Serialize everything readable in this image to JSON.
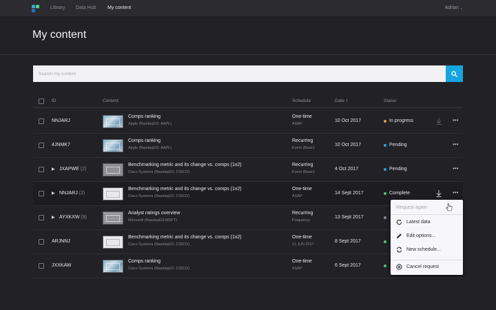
{
  "nav": {
    "links": [
      {
        "label": "Library"
      },
      {
        "label": "Data Hub"
      },
      {
        "label": "My content"
      }
    ],
    "user": "Adrian"
  },
  "page": {
    "title": "My content"
  },
  "search": {
    "placeholder": "Search my content"
  },
  "table": {
    "headers": {
      "id": "ID",
      "content": "Content",
      "schedule": "Schedule",
      "date": "Date",
      "status": "Status"
    },
    "sort": {
      "column": "Date",
      "direction": "ascending"
    },
    "rows": [
      {
        "id": "NNJARJ",
        "count": "",
        "expandable": false,
        "thumb": "blue",
        "title": "Comps ranking",
        "subtitle": "Apple (NasdaqGS: AAPL)",
        "schedule": "One-time",
        "schedule_detail": "ASAP",
        "date": "10 Oct 2017",
        "status": "In progress",
        "status_color": "#e8a32c",
        "download": true
      },
      {
        "id": "4JNMK7",
        "count": "",
        "expandable": false,
        "thumb": "blue",
        "title": "Comps ranking",
        "subtitle": "Apple (NasdaqGS: AAPL)",
        "schedule": "Recurring",
        "schedule_detail": "Event (Basic)",
        "date": "10 Oct 2017",
        "status": "Pending",
        "status_color": "#1fa8e6",
        "download": false
      },
      {
        "id": "JXAPWE",
        "count": "(2)",
        "expandable": true,
        "thumb": "grey",
        "title": "Benchmarking metric and its change vs. comps (1x2)",
        "subtitle": "Cisco Systems (NasdaqGS: CISCO)",
        "schedule": "Recurring",
        "schedule_detail": "Event (Basic)",
        "date": "4 Oct 2017",
        "status": "Pending",
        "status_color": "#1fa8e6",
        "download": false
      },
      {
        "id": "NNJARJ",
        "count": "(2)",
        "expandable": true,
        "thumb": "white",
        "title": "Benchmarking metric and its change vs. comps (1x2)",
        "subtitle": "Cisco Systems (NasdaqGS: CISCO)",
        "schedule": "One-time",
        "schedule_detail": "ASAP",
        "date": "14 Sept 2017",
        "status": "Complete",
        "status_color": "#43c97a",
        "download": true
      },
      {
        "id": "AYXKXW",
        "count": "(9)",
        "expandable": true,
        "thumb": "gridgrey",
        "title": "Analyst ratings overview",
        "subtitle": "Microsoft (NasdaqGS:MSFT)",
        "schedule": "Recurring",
        "schedule_detail": "Frequency",
        "date": "13 Sept 2017",
        "status": "",
        "status_color": "#8a8a92",
        "download": false
      },
      {
        "id": "ARJNNJ",
        "count": "",
        "expandable": false,
        "thumb": "white",
        "title": "Benchmarking metric and its change vs. comps (1x2)",
        "subtitle": "Cisco Systems (NasdaqGS: CISCO)",
        "schedule": "One-time",
        "schedule_detail": "11 JUN 2017",
        "date": "8 Sept 2017",
        "status": "",
        "status_color": "#43c97a",
        "download": false
      },
      {
        "id": "JXXKAW",
        "count": "",
        "expandable": false,
        "thumb": "blue",
        "title": "Comps ranking",
        "subtitle": "Cisco Systems (NasdaqGS: CISCO)",
        "schedule": "One-time",
        "schedule_detail": "ASAP",
        "date": "6 Sept 2017",
        "status": "",
        "status_color": "#43c97a",
        "download": false
      }
    ]
  },
  "context_menu": {
    "items": [
      {
        "label": "Request again",
        "icon": "none",
        "disabled": true
      },
      {
        "label": "Latest data",
        "icon": "refresh-icon",
        "disabled": false
      },
      {
        "label": "Edit options...",
        "icon": "pencil-icon",
        "disabled": false
      },
      {
        "label": "New schedule...",
        "icon": "schedule-icon",
        "disabled": false
      },
      {
        "label": "Cancel request",
        "icon": "cancel-icon",
        "disabled": false
      }
    ]
  },
  "colors": {
    "accent": "#17a5e0",
    "background": "#222226",
    "nav": "#2b2b30"
  }
}
